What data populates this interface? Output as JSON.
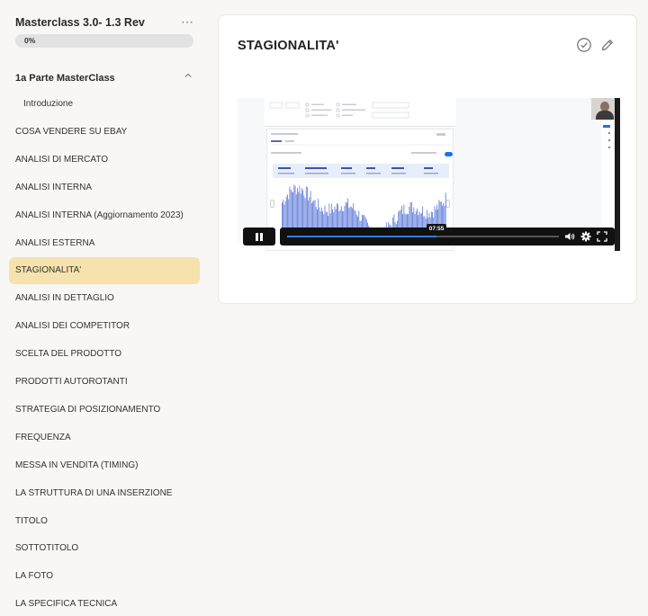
{
  "course": {
    "title": "Masterclass 3.0- 1.3 Rev",
    "more_icon": "⋯",
    "progress_label": "0%",
    "progress_value": 0
  },
  "section": {
    "title": "1a Parte MasterClass",
    "icon": "chevron-up-icon"
  },
  "lessons": [
    {
      "label": "Introduzione",
      "sub": true,
      "active": false
    },
    {
      "label": "COSA VENDERE SU EBAY",
      "sub": false,
      "active": false
    },
    {
      "label": "ANALISI DI MERCATO",
      "sub": false,
      "active": false
    },
    {
      "label": "ANALISI INTERNA",
      "sub": false,
      "active": false
    },
    {
      "label": "ANALISI INTERNA (Aggiornamento 2023)",
      "sub": false,
      "active": false
    },
    {
      "label": "ANALISI ESTERNA",
      "sub": false,
      "active": false
    },
    {
      "label": "STAGIONALITA'",
      "sub": false,
      "active": true
    },
    {
      "label": "ANALISI IN DETTAGLIO",
      "sub": false,
      "active": false
    },
    {
      "label": "ANALISI DEI COMPETITOR",
      "sub": false,
      "active": false
    },
    {
      "label": "SCELTA DEL PRODOTTO",
      "sub": false,
      "active": false
    },
    {
      "label": "PRODOTTI AUTOROTANTI",
      "sub": false,
      "active": false
    },
    {
      "label": "STRATEGIA DI POSIZIONAMENTO",
      "sub": false,
      "active": false
    },
    {
      "label": "FREQUENZA",
      "sub": false,
      "active": false
    },
    {
      "label": "MESSA IN VENDITA (TIMING)",
      "sub": false,
      "active": false
    },
    {
      "label": "LA STRUTTURA DI UNA INSERZIONE",
      "sub": false,
      "active": false
    },
    {
      "label": "TITOLO",
      "sub": false,
      "active": false
    },
    {
      "label": "SOTTOTITOLO",
      "sub": false,
      "active": false
    },
    {
      "label": "LA FOTO",
      "sub": false,
      "active": false
    },
    {
      "label": "LA SPECIFICA TECNICA",
      "sub": false,
      "active": false
    }
  ],
  "main": {
    "heading": "STAGIONALITA'",
    "complete_icon": "check-circle-icon",
    "edit_icon": "pencil-icon"
  },
  "video": {
    "state": "playing",
    "time_label": "07:55",
    "played_fraction": 0.55,
    "controls": [
      "pause-icon",
      "volume-icon",
      "settings-icon",
      "fullscreen-icon"
    ]
  },
  "colors": {
    "active_lesson_bg": "#f6e2ad",
    "page_bg": "#f8f7f5",
    "player_bg": "#111111",
    "progress_accent": "#2f7fe0",
    "chart_bars": "#5b78d8"
  }
}
